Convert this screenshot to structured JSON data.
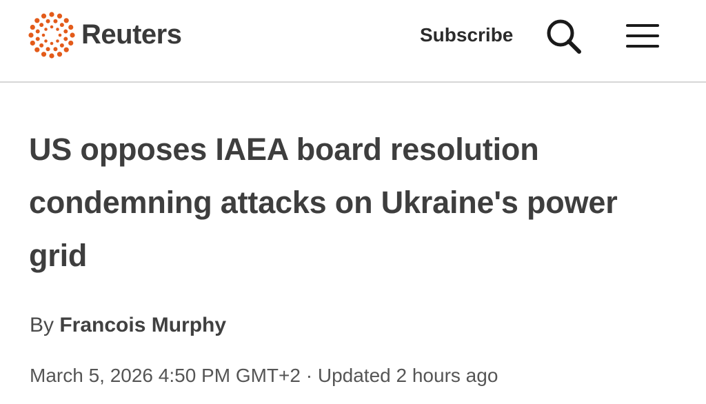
{
  "header": {
    "logo_text": "Reuters",
    "subscribe_label": "Subscribe",
    "search_icon": "search-icon",
    "menu_icon": "hamburger-menu-icon",
    "brand_color": "#e35b1a"
  },
  "article": {
    "headline": "US opposes IAEA board resolution condemning attacks on Ukraine's power grid",
    "byline_prefix": "By",
    "author": "Francois Murphy",
    "published": "March 5, 2026 4:50 PM GMT+2",
    "separator": "·",
    "updated": "Updated 2 hours ago"
  }
}
